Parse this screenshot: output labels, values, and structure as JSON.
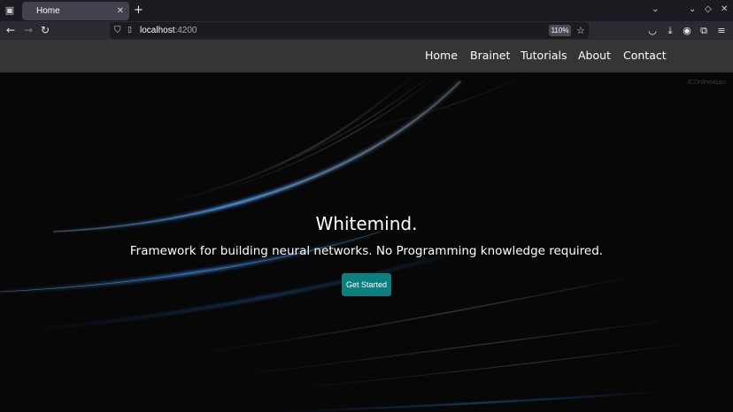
{
  "browser": {
    "tab": {
      "title": "Home",
      "close_glyph": "✕"
    },
    "new_tab_glyph": "+",
    "toolbar": {
      "back_glyph": "←",
      "forward_glyph": "→",
      "reload_glyph": "↻",
      "star_glyph": "☆"
    },
    "url": {
      "host": "localhost",
      "port": ":4200"
    },
    "zoom": "110%",
    "icons": [
      "tab-overview-icon",
      "shield-icon",
      "page-icon",
      "star-icon",
      "pocket-icon",
      "download-icon",
      "account-icon",
      "extensions-icon",
      "menu-icon",
      "list-all-tabs-icon",
      "minimize-icon"
    ]
  },
  "site": {
    "nav": {
      "items": [
        {
          "label": "Home"
        },
        {
          "label": "Brainet"
        },
        {
          "label": "Tutorials"
        },
        {
          "label": "About"
        },
        {
          "label": "Contact"
        }
      ]
    },
    "hero": {
      "watermark": "JCOnlineApps",
      "title": "Whitemind.",
      "subtitle": "Framework for building neural networks. No Programming knowledge required.",
      "cta_label": "Get Started"
    }
  },
  "colors": {
    "nav_background": "#353535",
    "hero_background": "#070708",
    "cta_background": "#0e7f7f",
    "accent_blue": "#2a78c8"
  }
}
